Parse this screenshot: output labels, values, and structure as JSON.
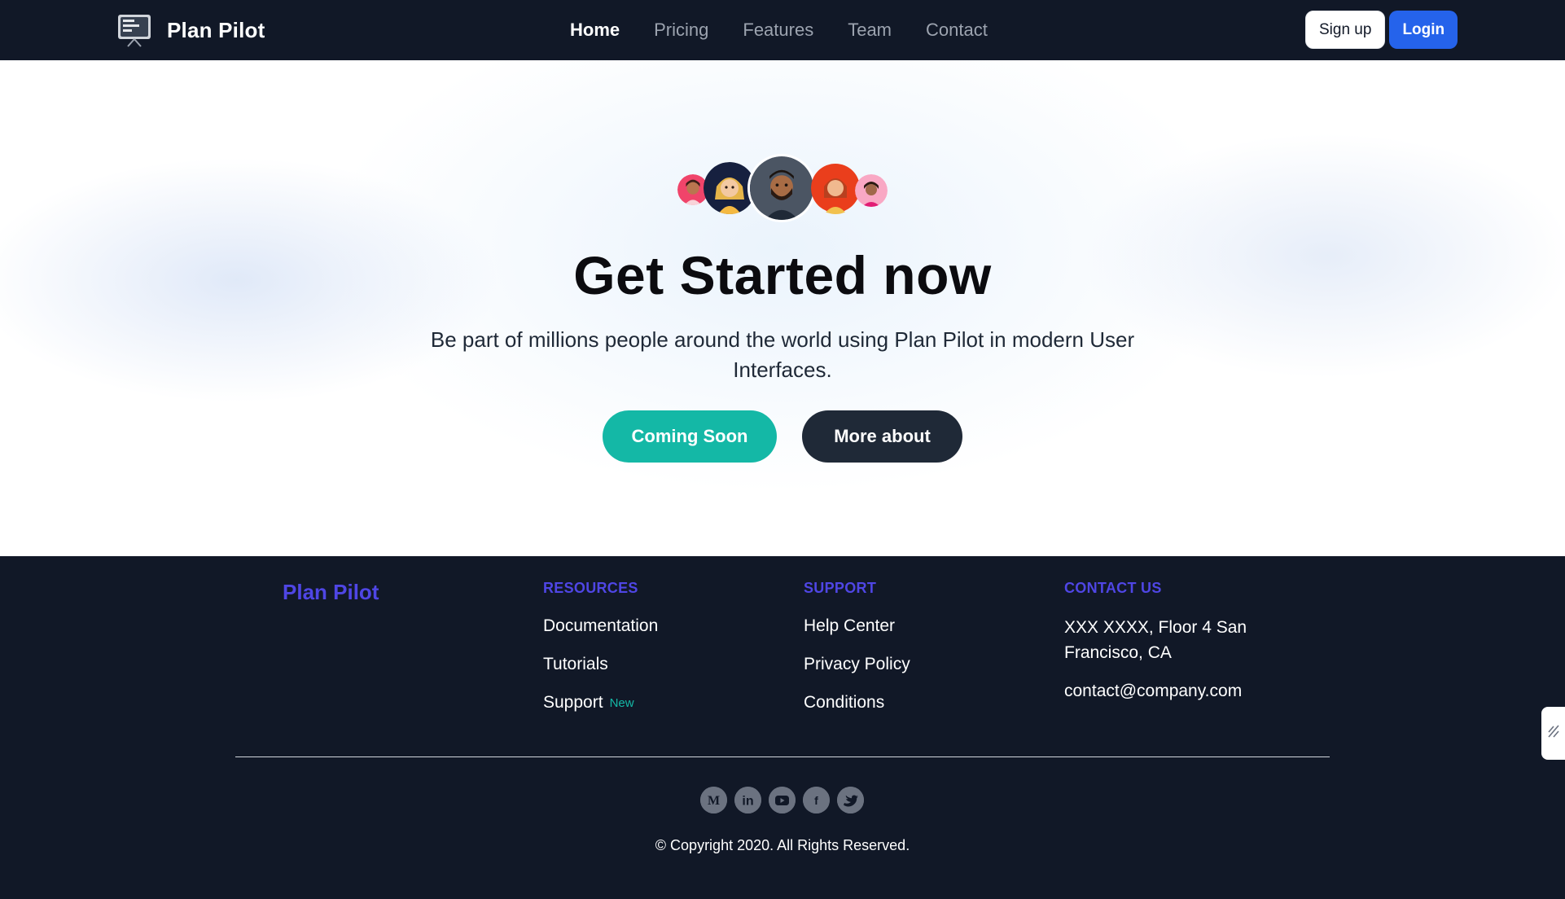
{
  "header": {
    "brand_name": "Plan Pilot",
    "logo_icon": "kanban-board-icon",
    "nav": [
      {
        "label": "Home",
        "active": true
      },
      {
        "label": "Pricing",
        "active": false
      },
      {
        "label": "Features",
        "active": false
      },
      {
        "label": "Team",
        "active": false
      },
      {
        "label": "Contact",
        "active": false
      }
    ],
    "signup_label": "Sign up",
    "login_label": "Login"
  },
  "hero": {
    "title": "Get Started now",
    "subtitle": "Be part of millions people around the world using Plan Pilot in modern User Interfaces.",
    "primary_cta": "Coming Soon",
    "secondary_cta": "More about",
    "avatars": [
      "avatar-woman-pink",
      "avatar-blonde-navy",
      "avatar-bearded-man",
      "avatar-redhead-orange",
      "avatar-woman-pink-small"
    ]
  },
  "footer": {
    "brand_name": "Plan Pilot",
    "resources": {
      "heading": "RESOURCES",
      "links": [
        "Documentation",
        "Tutorials",
        "Support"
      ],
      "support_badge": "New"
    },
    "support": {
      "heading": "SUPPORT",
      "links": [
        "Help Center",
        "Privacy Policy",
        "Conditions"
      ]
    },
    "contact": {
      "heading": "CONTACT US",
      "address": "XXX XXXX, Floor 4 San Francisco, CA",
      "email": "contact@company.com"
    },
    "socials": [
      "medium-icon",
      "linkedin-icon",
      "youtube-icon",
      "facebook-icon",
      "twitter-icon"
    ],
    "copyright": "© Copyright 2020. All Rights Reserved."
  },
  "colors": {
    "nav_bg": "#111827",
    "accent_teal": "#14b8a6",
    "login_blue": "#2563eb",
    "footer_heading": "#4f46e5"
  }
}
